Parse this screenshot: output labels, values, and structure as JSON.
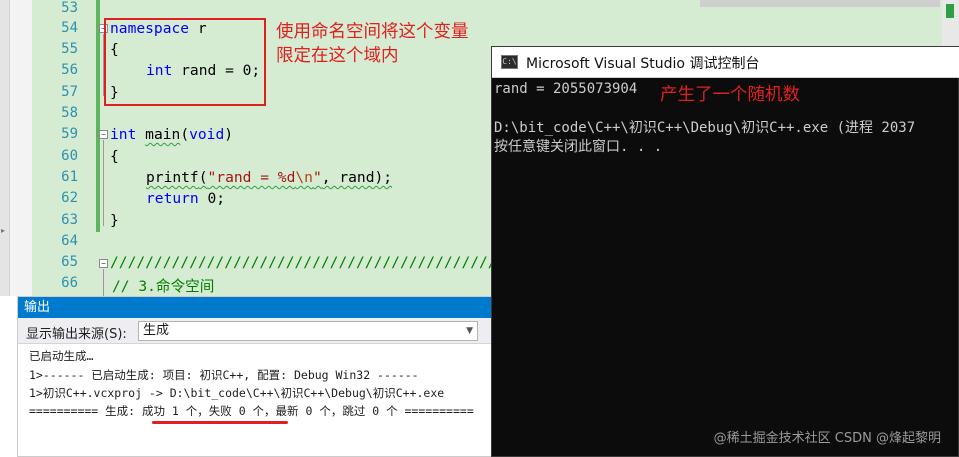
{
  "editor": {
    "line_numbers": [
      "53",
      "54",
      "55",
      "56",
      "57",
      "58",
      "59",
      "60",
      "61",
      "62",
      "63",
      "64",
      "65",
      "66"
    ],
    "code": {
      "ns_kw": "namespace",
      "ns_name": " r",
      "brace_open": "{",
      "int_kw": "int",
      "var_decl": " rand = 0;",
      "brace_close": "}",
      "main_kw_int": "int",
      "main_sig_a": " ",
      "main_name": "main",
      "main_paren_open": "(",
      "void_kw": "void",
      "main_paren_close": ")",
      "printf_fn": "printf",
      "printf_paren": "(",
      "printf_str_a": "\"rand = %d",
      "printf_esc": "\\n",
      "printf_str_b": "\"",
      "printf_rest": ", rand);",
      "return_kw": "return",
      "return_rest": " 0;",
      "comment_slashes": "////////////////////////////////////////////////////////////",
      "comment_title": "// 3.命令空间"
    },
    "annotation": "使用命名空间将这个变量\n限定在这个域内"
  },
  "console": {
    "title": "Microsoft Visual Studio 调试控制台",
    "icon_text": "C:\\",
    "output_line": "rand = 2055073904",
    "annotation": "产生了一个随机数",
    "exit_line": "D:\\bit_code\\C++\\初识C++\\Debug\\初识C++.exe (进程 2037",
    "prompt_line": "按任意键关闭此窗口. . ."
  },
  "output_panel": {
    "title": "输出",
    "source_label": "显示输出来源(S):",
    "source_value": "生成",
    "lines": [
      "已启动生成…",
      "1>------ 已启动生成: 项目: 初识C++, 配置: Debug Win32 ------",
      "1>初识C++.vcxproj -> D:\\bit_code\\C++\\初识C++\\Debug\\初识C++.exe",
      "========== 生成: 成功 1 个，失败 0 个，最新 0 个，跳过 0 个 =========="
    ]
  },
  "watermark": "@稀土掘金技术社区 CSDN @烽起黎明",
  "colors": {
    "editor_bg": "#d6ecd2",
    "annotation_red": "#e02020",
    "output_header": "#007acc",
    "console_bg": "#0c0c0c"
  }
}
